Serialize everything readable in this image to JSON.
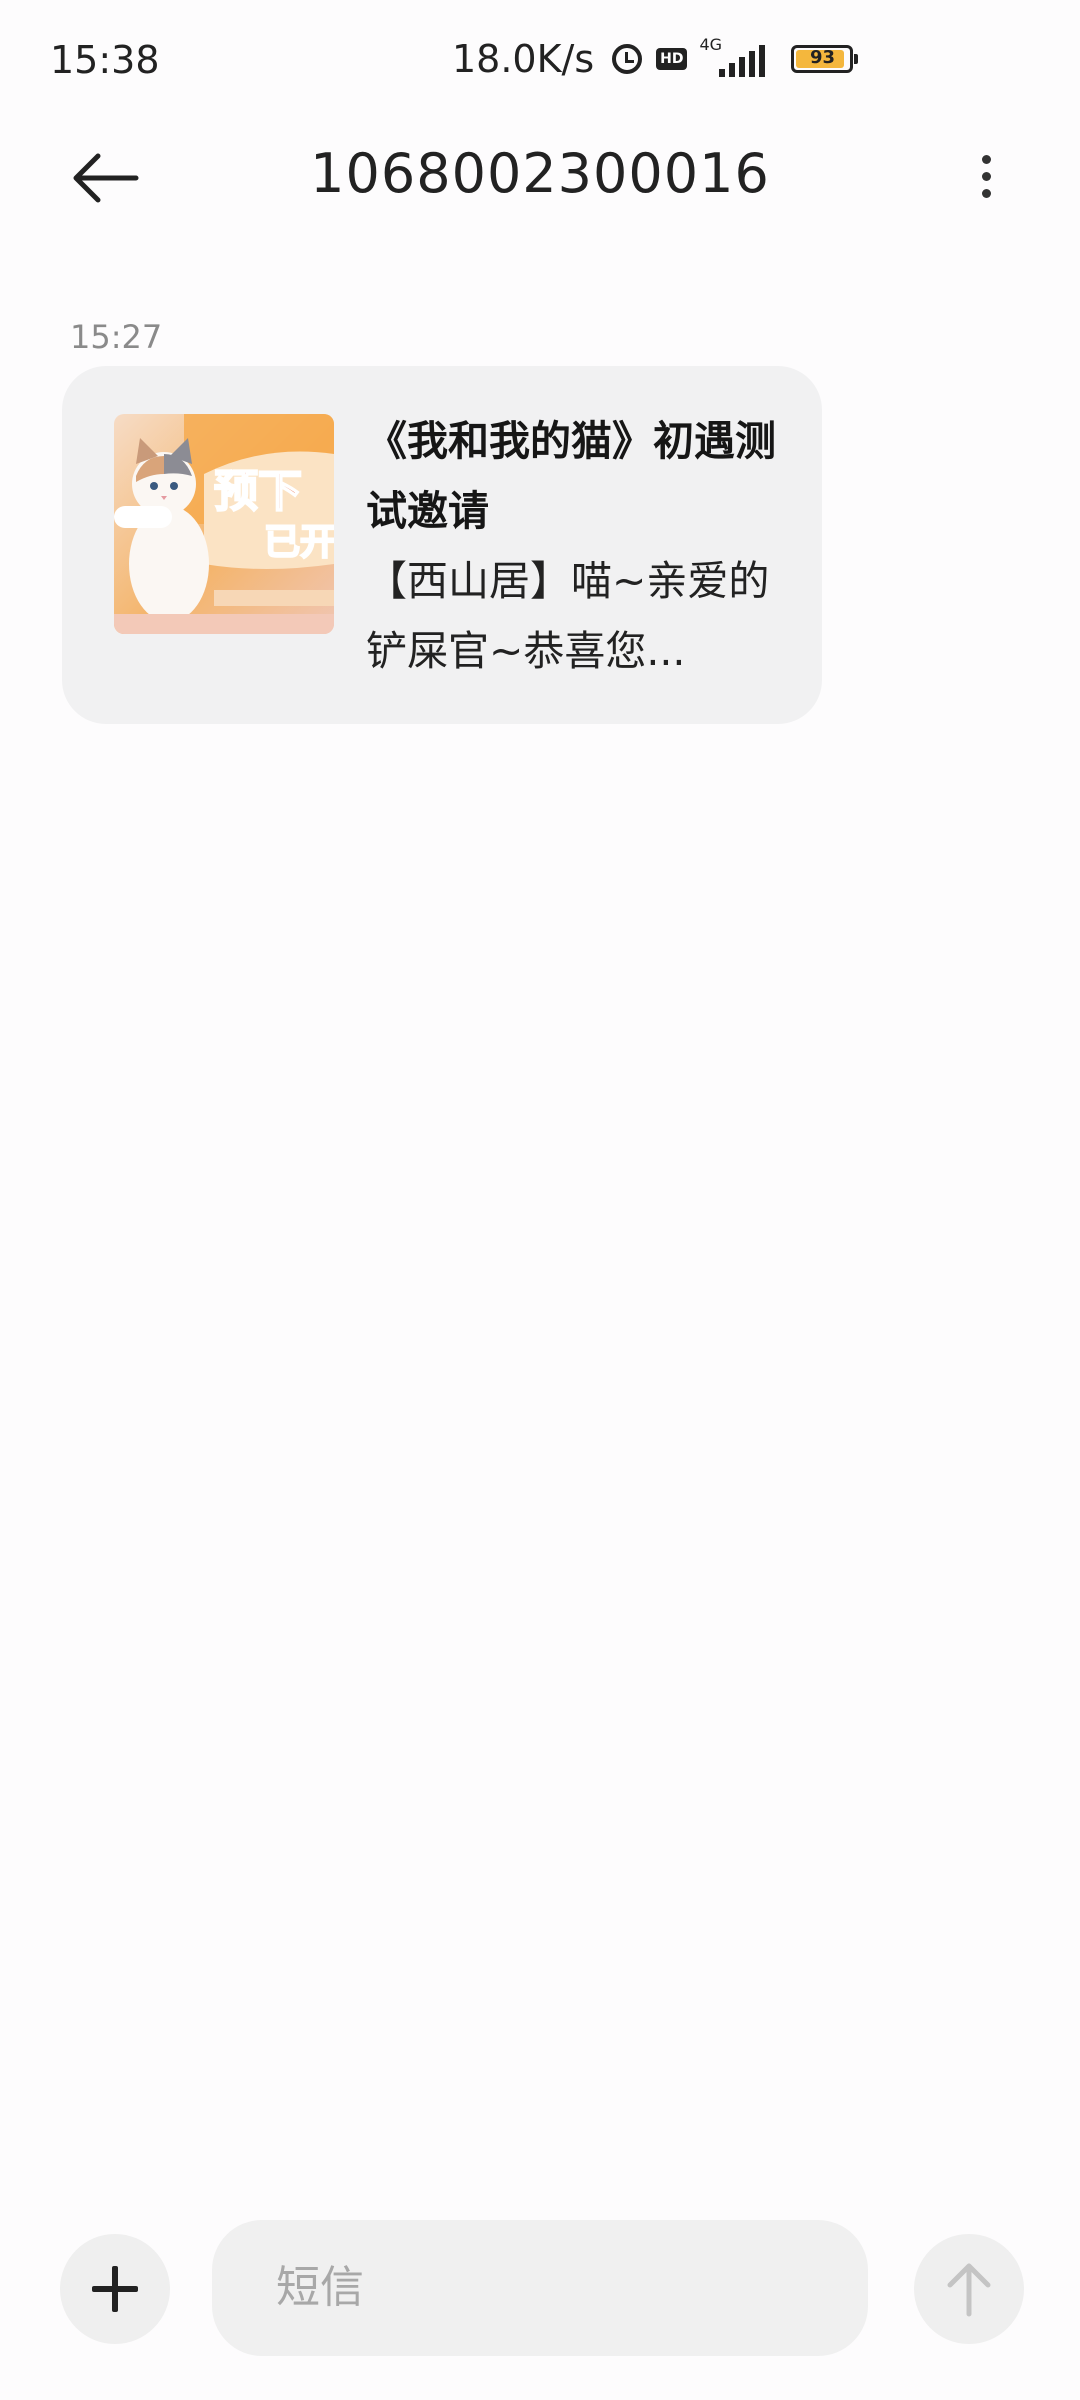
{
  "status_bar": {
    "time": "15:38",
    "net_speed": "18.0K/s",
    "hd_label": "HD",
    "network_type": "4G",
    "battery_percent": "93",
    "battery_level": 0.93,
    "battery_color": "#f4b73d",
    "icons": [
      "alarm-icon",
      "hd-icon",
      "signal-icon",
      "battery-icon"
    ]
  },
  "header": {
    "title": "1068002300016",
    "back_icon": "arrow-left-icon",
    "menu_icon": "more-vertical-icon"
  },
  "messages": [
    {
      "time": "15:27",
      "card": {
        "title": "《我和我的猫》初遇测试邀请",
        "body": "【西山居】喵~亲爱的铲屎官~恭喜您...",
        "image_desc": "cat-game-banner-thumbnail"
      }
    }
  ],
  "composer": {
    "placeholder": "短信",
    "add_icon": "plus-icon",
    "send_icon": "arrow-up-icon"
  }
}
